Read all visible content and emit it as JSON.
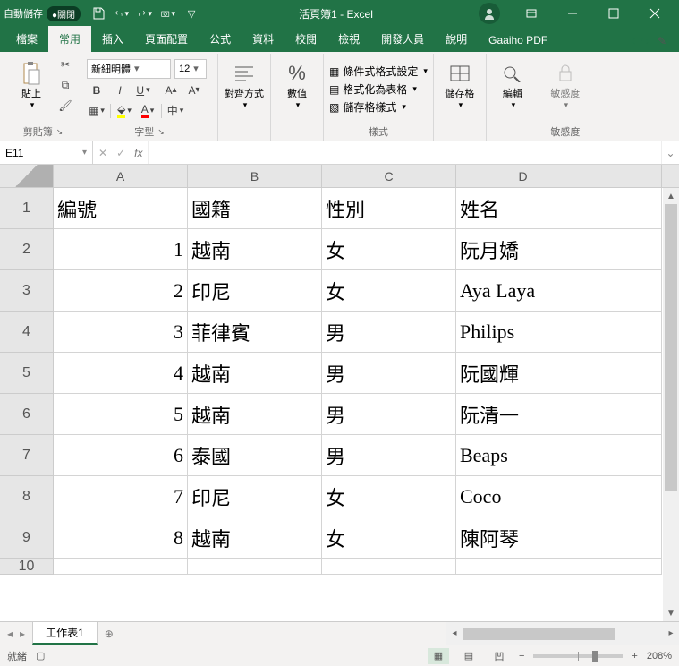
{
  "titlebar": {
    "autosave_label": "自動儲存",
    "autosave_state": "●關閉",
    "title": "活頁簿1 - Excel"
  },
  "ribbon_tabs": [
    "檔案",
    "常用",
    "插入",
    "頁面配置",
    "公式",
    "資料",
    "校閱",
    "檢視",
    "開發人員",
    "說明",
    "Gaaiho PDF"
  ],
  "ribbon": {
    "clipboard": {
      "paste": "貼上",
      "group": "剪貼簿"
    },
    "font": {
      "name": "新細明體",
      "size": "12",
      "group": "字型"
    },
    "alignment": {
      "btn": "對齊方式"
    },
    "number": {
      "btn": "數值",
      "pct": "%"
    },
    "styles": {
      "cond": "條件式格式設定",
      "table": "格式化為表格",
      "cell": "儲存格樣式",
      "group": "樣式"
    },
    "cells": {
      "btn": "儲存格"
    },
    "editing": {
      "btn": "編輯"
    },
    "sensitivity": {
      "btn": "敏感度",
      "group": "敏感度"
    }
  },
  "namebox": "E11",
  "sheet": {
    "columns": [
      "A",
      "B",
      "C",
      "D"
    ],
    "headers": {
      "A": "編號",
      "B": "國籍",
      "C": "性別",
      "D": "姓名"
    },
    "rows": [
      {
        "A": "1",
        "B": "越南",
        "C": "女",
        "D": "阮月嬌"
      },
      {
        "A": "2",
        "B": "印尼",
        "C": "女",
        "D": "Aya Laya"
      },
      {
        "A": "3",
        "B": "菲律賓",
        "C": "男",
        "D": "Philips"
      },
      {
        "A": "4",
        "B": "越南",
        "C": "男",
        "D": "阮國輝"
      },
      {
        "A": "5",
        "B": "越南",
        "C": "男",
        "D": "阮清一"
      },
      {
        "A": "6",
        "B": "泰國",
        "C": "男",
        "D": "Beaps"
      },
      {
        "A": "7",
        "B": "印尼",
        "C": "女",
        "D": "Coco"
      },
      {
        "A": "8",
        "B": "越南",
        "C": "女",
        "D": "陳阿琴"
      }
    ]
  },
  "sheettab": "工作表1",
  "status": {
    "ready": "就緒",
    "zoom": "208%"
  }
}
